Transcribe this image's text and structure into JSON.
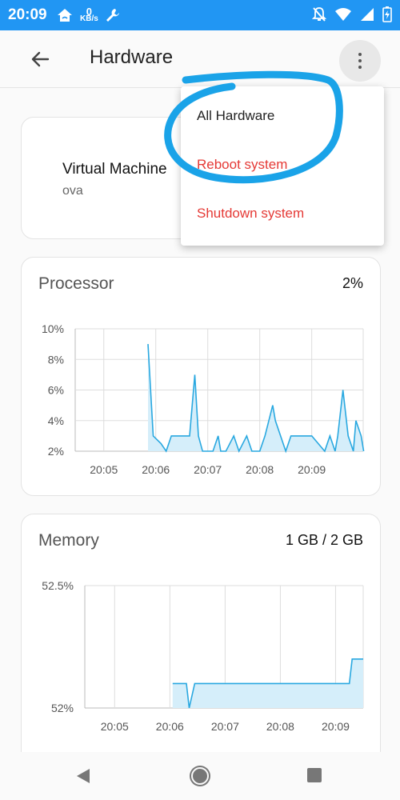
{
  "status_bar": {
    "time": "20:09",
    "net_speed_value": "0",
    "net_speed_unit": "KB/s",
    "icons": [
      "home-wifi-icon",
      "wrench-icon",
      "bell-off-icon",
      "wifi-icon",
      "signal-icon",
      "battery-charging-icon"
    ]
  },
  "app_bar": {
    "title": "Hardware",
    "back_icon": "arrow-back-icon",
    "more_icon": "more-vert-icon"
  },
  "vm_card": {
    "name": "Virtual Machine",
    "subtitle": "ova"
  },
  "menu": {
    "items": [
      {
        "label": "All Hardware",
        "color": "#222222"
      },
      {
        "label": "Reboot system",
        "color": "#e53935"
      },
      {
        "label": "Shutdown system",
        "color": "#e53935"
      }
    ]
  },
  "processor": {
    "title": "Processor",
    "value": "2%"
  },
  "memory": {
    "title": "Memory",
    "value": "1 GB / 2 GB"
  },
  "colors": {
    "accent": "#2196f3",
    "chart_line": "#29a8e0",
    "chart_fill": "#d5eefa",
    "annotation": "#1aa3e8",
    "danger": "#e53935"
  },
  "chart_data": [
    {
      "type": "area",
      "name": "processor",
      "title": "Processor",
      "xlabel": "",
      "ylabel": "",
      "x_ticks": [
        "20:05",
        "20:06",
        "20:07",
        "20:08",
        "20:09"
      ],
      "y_ticks": [
        "10%",
        "8%",
        "6%",
        "4%",
        "2%"
      ],
      "ylim": [
        2,
        10
      ],
      "x": [
        20.85,
        20.95,
        21.1,
        21.2,
        21.3,
        21.5,
        21.65,
        21.75,
        21.82,
        21.9,
        22.0,
        22.1,
        22.2,
        22.25,
        22.35,
        22.5,
        22.6,
        22.75,
        22.85,
        23.0,
        23.1,
        23.25,
        23.3,
        23.4,
        23.5,
        23.6,
        23.7,
        23.85,
        24.0,
        24.25,
        24.35,
        24.45,
        24.5,
        24.6,
        24.7,
        24.8,
        24.85,
        24.95,
        25.0
      ],
      "series": [
        {
          "values": [
            9,
            3,
            2.5,
            2,
            3,
            3,
            3,
            7,
            3,
            2,
            2,
            2,
            3,
            2,
            2,
            3,
            2,
            3,
            2,
            2,
            3,
            5,
            4,
            3,
            2,
            3,
            3,
            3,
            3,
            2,
            3,
            2,
            3,
            6,
            3,
            2,
            4,
            3,
            2
          ]
        }
      ],
      "grid": true
    },
    {
      "type": "area",
      "name": "memory",
      "title": "Memory",
      "xlabel": "",
      "ylabel": "",
      "x_ticks": [
        "20:05",
        "20:06",
        "20:07",
        "20:08",
        "20:09"
      ],
      "y_ticks": [
        "52.5%",
        "52%"
      ],
      "ylim": [
        52,
        52.5
      ],
      "x": [
        21.05,
        21.3,
        21.35,
        21.45,
        24.25,
        24.3,
        24.35,
        24.5
      ],
      "series": [
        {
          "values": [
            52.1,
            52.1,
            52.0,
            52.1,
            52.1,
            52.2,
            52.2,
            52.2
          ]
        }
      ],
      "grid": true
    }
  ]
}
